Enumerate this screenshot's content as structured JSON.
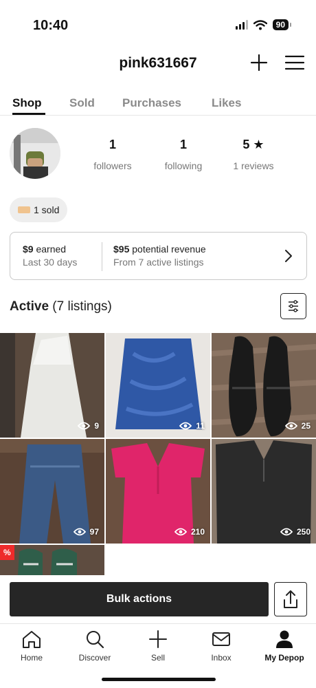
{
  "status_bar": {
    "time": "10:40",
    "battery": "90"
  },
  "header": {
    "username": "pink631667"
  },
  "tabs": [
    {
      "label": "Shop",
      "active": true
    },
    {
      "label": "Sold",
      "active": false
    },
    {
      "label": "Purchases",
      "active": false
    },
    {
      "label": "Likes",
      "active": false
    }
  ],
  "profile": {
    "followers": {
      "value": "1",
      "label": "followers"
    },
    "following": {
      "value": "1",
      "label": "following"
    },
    "rating": {
      "value": "5 ★",
      "label": "1 reviews"
    }
  },
  "sold_chip": {
    "label": "1 sold"
  },
  "revenue": {
    "earned_amount": "$9",
    "earned_word": " earned",
    "earned_sub": "Last 30 days",
    "potential_amount": "$95",
    "potential_word": " potential revenue",
    "potential_sub": "From 7 active listings"
  },
  "active": {
    "title": "Active",
    "count": " (7 listings)"
  },
  "listings": [
    {
      "views": "9",
      "item": "white dress"
    },
    {
      "views": "11",
      "item": "blue skirt"
    },
    {
      "views": "25",
      "item": "black shoes"
    },
    {
      "views": "97",
      "item": "blue jeans"
    },
    {
      "views": "210",
      "item": "pink top"
    },
    {
      "views": "250",
      "item": "black blouse"
    },
    {
      "views": "",
      "item": "green sneakers",
      "badge": "%"
    }
  ],
  "actions": {
    "bulk_label": "Bulk actions"
  },
  "nav": [
    {
      "label": "Home",
      "icon": "home-icon"
    },
    {
      "label": "Discover",
      "icon": "search-icon"
    },
    {
      "label": "Sell",
      "icon": "plus-icon"
    },
    {
      "label": "Inbox",
      "icon": "mail-icon"
    },
    {
      "label": "My Depop",
      "icon": "person-icon",
      "active": true
    }
  ],
  "colors": {
    "primary_dark": "#262626",
    "sale_badge": "#ee2b2b",
    "muted_text": "#777777"
  }
}
